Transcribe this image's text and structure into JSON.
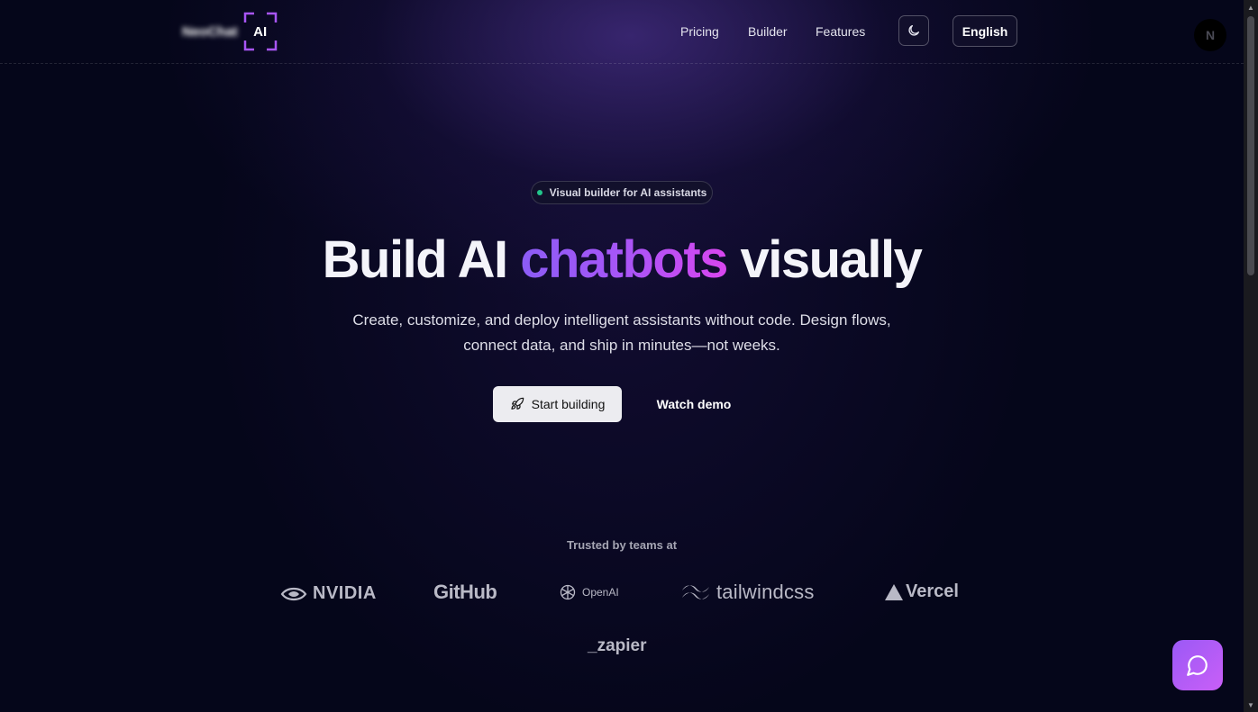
{
  "header": {
    "brand": {
      "name": "NeoChat",
      "badge": "AI"
    },
    "nav": [
      {
        "label": "Pricing"
      },
      {
        "label": "Builder"
      },
      {
        "label": "Features"
      }
    ],
    "theme_icon": "moon-icon",
    "language": "English",
    "avatar_initial": "N"
  },
  "hero": {
    "pill_label": "Visual builder for AI assistants",
    "headline": {
      "part1": "Build AI",
      "highlight": "chatbots",
      "part2": "visually"
    },
    "subtitle_line1": "Create, customize, and deploy intelligent assistants without code. Design flows,",
    "subtitle_line2": "connect data, and ship in minutes—not weeks.",
    "primary_cta": "Start building",
    "primary_cta_icon": "rocket-icon",
    "secondary_cta": "Watch demo"
  },
  "trusted": {
    "label": "Trusted by teams at",
    "logos": [
      {
        "name": "NVIDIA",
        "icon": "nvidia-eye-icon"
      },
      {
        "name": "GitHub"
      },
      {
        "name": "OpenAI",
        "icon": "openai-knot-icon"
      },
      {
        "name": "tailwindcss",
        "icon": "tailwind-wave-icon"
      },
      {
        "name": "Vercel",
        "icon": "vercel-triangle-icon"
      },
      {
        "name": "_zapier"
      }
    ]
  },
  "chat_widget_icon": "chat-bubble-icon",
  "colors": {
    "background": "#05061a",
    "accent_gradient_start": "#8b5cf6",
    "accent_gradient_end": "#d946ef",
    "status_dot": "#22c58b"
  }
}
